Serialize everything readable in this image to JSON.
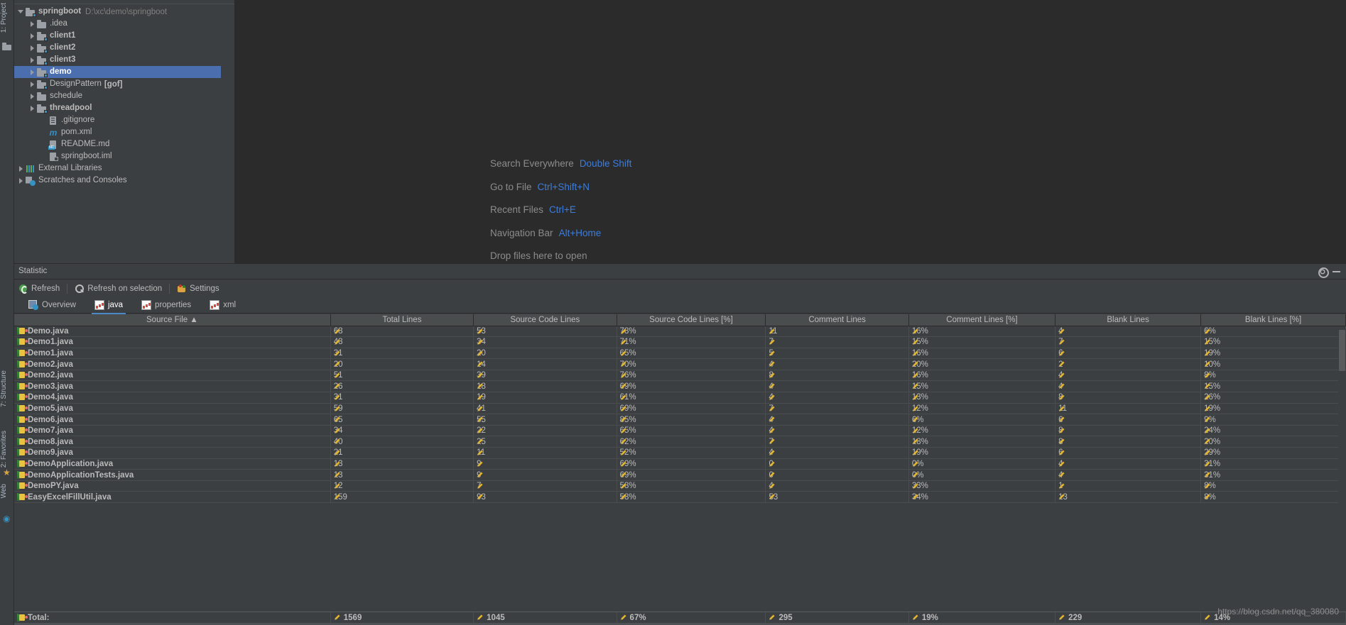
{
  "rail": {
    "left_top": [
      {
        "label": "1: Project",
        "icon": "folder-icon"
      }
    ],
    "left_bottom": [
      {
        "label": "7: Structure",
        "icon": "structure-icon"
      },
      {
        "label": "2: Favorites",
        "icon": "star-icon"
      },
      {
        "label": "Web",
        "icon": "web-icon"
      }
    ]
  },
  "project_tree": [
    {
      "indent": 0,
      "arrow": "down",
      "icon": "module-folder-icon",
      "label": "springboot",
      "bold": true,
      "path": "D:\\xc\\demo\\springboot",
      "selected": false
    },
    {
      "indent": 1,
      "arrow": "right",
      "icon": "folder-icon",
      "label": ".idea",
      "bold": false,
      "selected": false
    },
    {
      "indent": 1,
      "arrow": "right",
      "icon": "module-folder-icon",
      "label": "client1",
      "bold": true,
      "selected": false
    },
    {
      "indent": 1,
      "arrow": "right",
      "icon": "module-folder-icon",
      "label": "client2",
      "bold": true,
      "selected": false
    },
    {
      "indent": 1,
      "arrow": "right",
      "icon": "module-folder-icon",
      "label": "client3",
      "bold": true,
      "selected": false
    },
    {
      "indent": 1,
      "arrow": "right",
      "icon": "module-folder-icon",
      "label": "demo",
      "bold": true,
      "selected": true
    },
    {
      "indent": 1,
      "arrow": "right",
      "icon": "module-folder-icon",
      "label": "DesignPattern",
      "bold": false,
      "suffix": "[gof]",
      "selected": false
    },
    {
      "indent": 1,
      "arrow": "right",
      "icon": "folder-icon",
      "label": "schedule",
      "bold": false,
      "selected": false
    },
    {
      "indent": 1,
      "arrow": "right",
      "icon": "module-folder-icon",
      "label": "threadpool",
      "bold": true,
      "selected": false
    },
    {
      "indent": 2,
      "arrow": "none",
      "icon": "gitignore-file-icon",
      "label": ".gitignore",
      "bold": false,
      "selected": false
    },
    {
      "indent": 2,
      "arrow": "none",
      "icon": "maven-icon",
      "label": "pom.xml",
      "bold": false,
      "selected": false
    },
    {
      "indent": 2,
      "arrow": "none",
      "icon": "markdown-file-icon",
      "label": "README.md",
      "bold": false,
      "selected": false
    },
    {
      "indent": 2,
      "arrow": "none",
      "icon": "iml-file-icon",
      "label": "springboot.iml",
      "bold": false,
      "selected": false
    },
    {
      "indent": 0,
      "arrow": "right",
      "icon": "external-libraries-icon",
      "label": "External Libraries",
      "bold": false,
      "selected": false
    },
    {
      "indent": 0,
      "arrow": "right",
      "icon": "scratches-icon",
      "label": "Scratches and Consoles",
      "bold": false,
      "selected": false
    }
  ],
  "editor_hints": [
    {
      "action": "Search Everywhere",
      "shortcut": "Double Shift"
    },
    {
      "action": "Go to File",
      "shortcut": "Ctrl+Shift+N"
    },
    {
      "action": "Recent Files",
      "shortcut": "Ctrl+E"
    },
    {
      "action": "Navigation Bar",
      "shortcut": "Alt+Home"
    },
    {
      "action": "Drop files here to open",
      "shortcut": ""
    }
  ],
  "statistic": {
    "title": "Statistic",
    "toolbar": [
      {
        "label": "Refresh",
        "icon": "refresh-icon"
      },
      {
        "label": "Refresh on selection",
        "icon": "magnifier-icon"
      },
      {
        "label": "Settings",
        "icon": "settings-icon"
      }
    ],
    "tabs": [
      {
        "label": "Overview",
        "icon": "overview-icon",
        "active": false
      },
      {
        "label": "java",
        "icon": "chart-icon",
        "active": true
      },
      {
        "label": "properties",
        "icon": "chart-icon",
        "active": false
      },
      {
        "label": "xml",
        "icon": "chart-icon",
        "active": false
      }
    ],
    "header_buttons": [
      {
        "name": "gear-icon"
      },
      {
        "name": "minimize-icon"
      }
    ],
    "columns": [
      "Source File ▲",
      "Total Lines",
      "Source Code Lines",
      "Source Code Lines [%]",
      "Comment Lines",
      "Comment Lines [%]",
      "Blank Lines",
      "Blank Lines [%]"
    ],
    "rows": [
      {
        "file": "Demo.java",
        "total": "68",
        "src": "53",
        "src_pct": "78%",
        "comment": "11",
        "comment_pct": "16%",
        "blank": "4",
        "blank_pct": "6%"
      },
      {
        "file": "Demo1.java",
        "total": "48",
        "src": "34",
        "src_pct": "71%",
        "comment": "7",
        "comment_pct": "15%",
        "blank": "7",
        "blank_pct": "15%"
      },
      {
        "file": "Demo1.java",
        "total": "31",
        "src": "20",
        "src_pct": "65%",
        "comment": "5",
        "comment_pct": "16%",
        "blank": "6",
        "blank_pct": "19%"
      },
      {
        "file": "Demo2.java",
        "total": "20",
        "src": "14",
        "src_pct": "70%",
        "comment": "4",
        "comment_pct": "20%",
        "blank": "2",
        "blank_pct": "10%"
      },
      {
        "file": "Demo2.java",
        "total": "51",
        "src": "39",
        "src_pct": "76%",
        "comment": "8",
        "comment_pct": "16%",
        "blank": "4",
        "blank_pct": "8%"
      },
      {
        "file": "Demo3.java",
        "total": "26",
        "src": "18",
        "src_pct": "69%",
        "comment": "4",
        "comment_pct": "15%",
        "blank": "4",
        "blank_pct": "15%"
      },
      {
        "file": "Demo4.java",
        "total": "31",
        "src": "19",
        "src_pct": "61%",
        "comment": "4",
        "comment_pct": "13%",
        "blank": "8",
        "blank_pct": "26%"
      },
      {
        "file": "Demo5.java",
        "total": "59",
        "src": "41",
        "src_pct": "69%",
        "comment": "7",
        "comment_pct": "12%",
        "blank": "11",
        "blank_pct": "19%"
      },
      {
        "file": "Demo6.java",
        "total": "65",
        "src": "55",
        "src_pct": "85%",
        "comment": "4",
        "comment_pct": "6%",
        "blank": "6",
        "blank_pct": "9%"
      },
      {
        "file": "Demo7.java",
        "total": "34",
        "src": "22",
        "src_pct": "65%",
        "comment": "4",
        "comment_pct": "12%",
        "blank": "8",
        "blank_pct": "24%"
      },
      {
        "file": "Demo8.java",
        "total": "40",
        "src": "25",
        "src_pct": "62%",
        "comment": "7",
        "comment_pct": "18%",
        "blank": "8",
        "blank_pct": "20%"
      },
      {
        "file": "Demo9.java",
        "total": "21",
        "src": "11",
        "src_pct": "52%",
        "comment": "4",
        "comment_pct": "19%",
        "blank": "6",
        "blank_pct": "29%"
      },
      {
        "file": "DemoApplication.java",
        "total": "13",
        "src": "9",
        "src_pct": "69%",
        "comment": "0",
        "comment_pct": "0%",
        "blank": "4",
        "blank_pct": "31%"
      },
      {
        "file": "DemoApplicationTests.java",
        "total": "13",
        "src": "9",
        "src_pct": "69%",
        "comment": "0",
        "comment_pct": "0%",
        "blank": "4",
        "blank_pct": "31%"
      },
      {
        "file": "DemoPY.java",
        "total": "12",
        "src": "7",
        "src_pct": "58%",
        "comment": "4",
        "comment_pct": "33%",
        "blank": "1",
        "blank_pct": "8%"
      },
      {
        "file": "EasyExcelFillUtil.java",
        "total": "159",
        "src": "93",
        "src_pct": "58%",
        "comment": "53",
        "comment_pct": "34%",
        "blank": "13",
        "blank_pct": "8%"
      }
    ],
    "total_row": {
      "file": "Total:",
      "total": "1569",
      "src": "1045",
      "src_pct": "67%",
      "comment": "295",
      "comment_pct": "19%",
      "blank": "229",
      "blank_pct": "14%"
    }
  },
  "watermark": "https://blog.csdn.net/qq_380080",
  "colors": {
    "accent_blue": "#4b6eaf",
    "link_blue": "#3b7ddd",
    "panel_bg": "#3c3f41",
    "editor_bg": "#2b2b2b",
    "header_bg": "#4a4d4e",
    "text": "#bbbbbb",
    "muted": "#808080"
  }
}
